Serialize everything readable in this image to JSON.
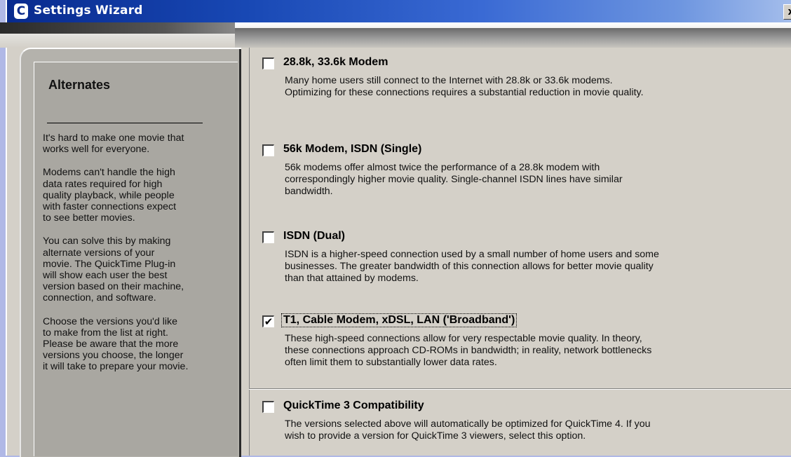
{
  "window": {
    "title": "Settings Wizard",
    "app_icon_glyph": "C",
    "close_glyph": "x"
  },
  "sidebar": {
    "heading": "Alternates",
    "paragraphs": [
      "It's hard to make one movie that\nworks well for everyone.",
      "Modems can't handle the high\ndata rates required for high\nquality playback, while people\nwith faster connections expect\nto see better movies.",
      "You can solve this by making\nalternate versions of your\nmovie. The QuickTime Plug-in\nwill show each user the best\nversion based on their machine,\nconnection, and software.",
      "Choose the versions you'd like\nto make from the list at right.\nPlease be aware that the more\nversions you choose, the longer\nit will take to prepare your movie."
    ]
  },
  "options": [
    {
      "label": "28.8k, 33.6k Modem",
      "description": "Many home users still connect to the Internet with 28.8k or 33.6k modems.\nOptimizing for these connections requires a substantial reduction in movie quality.",
      "checked": false
    },
    {
      "label": "56k Modem, ISDN (Single)",
      "description": "56k modems offer almost twice the performance of a 28.8k modem with\ncorrespondingly higher movie quality.  Single-channel ISDN lines have similar\nbandwidth.",
      "checked": false
    },
    {
      "label": "ISDN (Dual)",
      "description": "ISDN is a higher-speed connection used by a small number of home users and some\nbusinesses.  The greater bandwidth of this connection allows for better movie quality\nthan that attained by modems.",
      "checked": false
    },
    {
      "label": "T1, Cable Modem, xDSL, LAN ('Broadband')",
      "description": "These high-speed connections allow for very respectable movie quality.  In theory,\nthese connections approach CD-ROMs in bandwidth; in reality, network bottlenecks\noften limit them to substantially lower data rates.",
      "checked": true
    },
    {
      "label": "QuickTime 3 Compatibility",
      "description": "The versions selected above will automatically be optimized for QuickTime 4.  If you\nwish to provide a version for QuickTime 3 viewers, select this option.",
      "checked": false
    }
  ],
  "check_glyph": "✔"
}
